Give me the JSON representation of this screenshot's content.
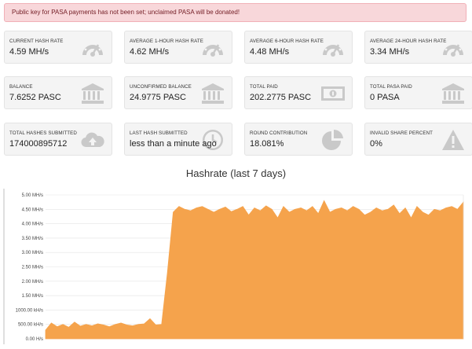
{
  "alert": {
    "text": "Public key for PASA payments has not been set; unclaimed PASA will be donated!"
  },
  "stats": [
    {
      "label": "CURRENT HASH RATE",
      "value": "4.59 MH/s",
      "icon": "speedometer-icon"
    },
    {
      "label": "AVERAGE 1-HOUR HASH RATE",
      "value": "4.62 MH/s",
      "icon": "speedometer-icon"
    },
    {
      "label": "AVERAGE 6-HOUR HASH RATE",
      "value": "4.48 MH/s",
      "icon": "speedometer-icon"
    },
    {
      "label": "AVERAGE 24-HOUR HASH RATE",
      "value": "3.34 MH/s",
      "icon": "speedometer-icon"
    },
    {
      "label": "BALANCE",
      "value": "7.6252 PASC",
      "icon": "bank-icon"
    },
    {
      "label": "UNCONFIRMED BALANCE",
      "value": "24.9775 PASC",
      "icon": "bank-icon"
    },
    {
      "label": "TOTAL PAID",
      "value": "202.2775 PASC",
      "icon": "banknote-icon"
    },
    {
      "label": "TOTAL PASA PAID",
      "value": "0 PASA",
      "icon": "bank-icon"
    },
    {
      "label": "TOTAL HASHES SUBMITTED",
      "value": "174000895712",
      "icon": "cloud-upload-icon"
    },
    {
      "label": "LAST HASH SUBMITTED",
      "value": "less than a minute ago",
      "icon": "clock-icon"
    },
    {
      "label": "ROUND CONTRIBUTION",
      "value": "18.081%",
      "icon": "pie-chart-icon"
    },
    {
      "label": "INVALID SHARE PERCENT",
      "value": "0%",
      "icon": "warning-icon"
    }
  ],
  "colors": {
    "area": "#f5a34c",
    "alert_bg": "#f8d7da",
    "alert_text": "#721c24",
    "card_bg": "#f4f4f4",
    "icon": "#c9c9c9"
  },
  "chart_data": {
    "type": "area",
    "title": "Hashrate (last 7 days)",
    "y_unit": "MH/s",
    "ylim": [
      0,
      5.0
    ],
    "y_ticks": [
      {
        "value": 5.0,
        "label": "5.00 MH/s"
      },
      {
        "value": 4.5,
        "label": "4.50 MH/s"
      },
      {
        "value": 4.0,
        "label": "4.00 MH/s"
      },
      {
        "value": 3.5,
        "label": "3.50 MH/s"
      },
      {
        "value": 3.0,
        "label": "3.00 MH/s"
      },
      {
        "value": 2.5,
        "label": "2.50 MH/s"
      },
      {
        "value": 2.0,
        "label": "2.00 MH/s"
      },
      {
        "value": 1.5,
        "label": "1.50 MH/s"
      },
      {
        "value": 1.0,
        "label": "1000.00 kH/s"
      },
      {
        "value": 0.5,
        "label": "500.00 kH/s"
      },
      {
        "value": 0.0,
        "label": "0.00 H/s"
      }
    ],
    "grid": true,
    "values": [
      0.3,
      0.55,
      0.42,
      0.5,
      0.4,
      0.58,
      0.44,
      0.5,
      0.45,
      0.52,
      0.48,
      0.42,
      0.5,
      0.55,
      0.48,
      0.45,
      0.5,
      0.52,
      0.7,
      0.48,
      0.5,
      2.3,
      4.4,
      4.6,
      4.5,
      4.45,
      4.55,
      4.6,
      4.5,
      4.4,
      4.5,
      4.58,
      4.42,
      4.5,
      4.6,
      4.3,
      4.55,
      4.45,
      4.62,
      4.5,
      4.2,
      4.6,
      4.4,
      4.5,
      4.55,
      4.45,
      4.6,
      4.35,
      4.8,
      4.4,
      4.5,
      4.55,
      4.45,
      4.6,
      4.5,
      4.3,
      4.4,
      4.55,
      4.45,
      4.5,
      4.65,
      4.35,
      4.55,
      4.2,
      4.6,
      4.4,
      4.3,
      4.5,
      4.45,
      4.55,
      4.6,
      4.5,
      4.75
    ]
  }
}
